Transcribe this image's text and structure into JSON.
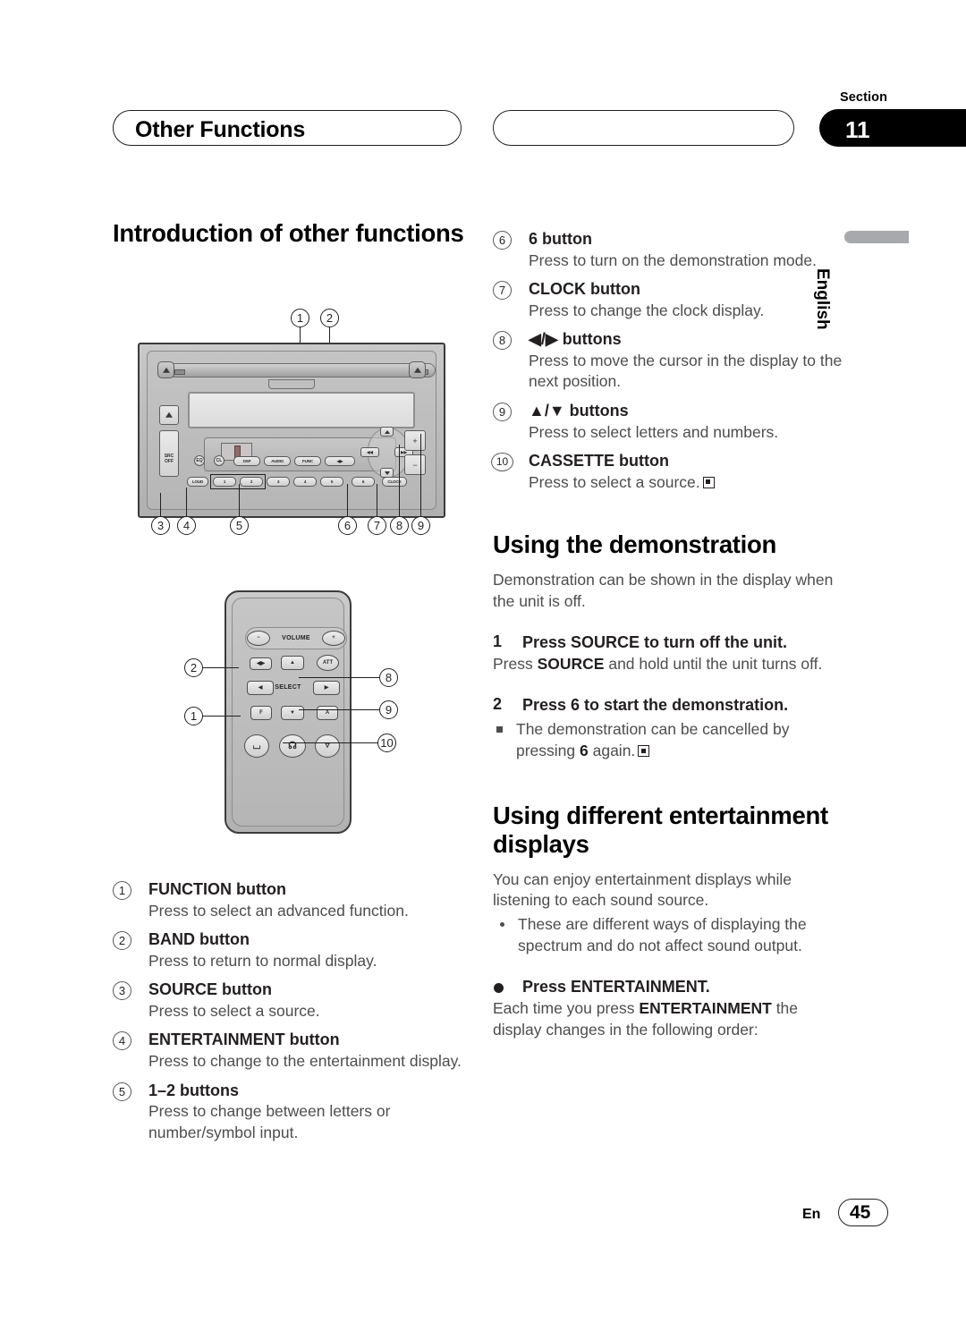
{
  "header": {
    "left_pill_title": "Other Functions",
    "right_pill_title": "",
    "section_word": "Section",
    "section_number": "11"
  },
  "side_tab": {
    "language": "English"
  },
  "left_column": {
    "heading": "Introduction of other functions",
    "button_list": [
      {
        "num": "1",
        "term": "FUNCTION button",
        "desc": "Press to select an advanced function."
      },
      {
        "num": "2",
        "term": "BAND button",
        "desc": "Press to return to normal display."
      },
      {
        "num": "3",
        "term": "SOURCE button",
        "desc": "Press to select a source."
      },
      {
        "num": "4",
        "term": "ENTERTAINMENT button",
        "desc": "Press to change to the entertainment display."
      },
      {
        "num": "5",
        "term": "1–2 buttons",
        "desc": "Press to change between letters or number/symbol input."
      }
    ]
  },
  "right_column": {
    "button_list": [
      {
        "num": "6",
        "term": "6 button",
        "desc": "Press to turn on the demonstration mode."
      },
      {
        "num": "7",
        "term": "CLOCK button",
        "desc": "Press to change the clock display."
      },
      {
        "num": "8",
        "term": "◀/▶ buttons",
        "desc": "Press to move the cursor in the display to the next position."
      },
      {
        "num": "9",
        "term": "▲/▼ buttons",
        "desc": "Press to select letters and numbers."
      },
      {
        "num": "10",
        "term": "CASSETTE button",
        "desc": "Press to select a source."
      }
    ],
    "demo": {
      "heading": "Using the demonstration",
      "intro": "Demonstration can be shown in the display when the unit is off.",
      "step1_num": "1",
      "step1_head": "Press SOURCE to turn off the unit.",
      "step1_body_a": "Press ",
      "step1_body_bold": "SOURCE",
      "step1_body_b": " and hold until the unit turns off.",
      "step2_num": "2",
      "step2_head": "Press 6 to start the demonstration.",
      "step2_note_a": "The demonstration can be cancelled by pressing ",
      "step2_note_bold": "6",
      "step2_note_b": " again."
    },
    "entertainment": {
      "heading": "Using different entertainment displays",
      "intro": "You can enjoy entertainment displays while listening to each sound source.",
      "bullet": "These are different ways of displaying the spectrum and do not affect sound output.",
      "step_head": "Press ENTERTAINMENT.",
      "step_body_a": "Each time you press ",
      "step_body_bold": "ENTERTAINMENT",
      "step_body_b": " the display changes in the following order:"
    }
  },
  "head_unit_diagram": {
    "callouts_top": [
      "1",
      "2"
    ],
    "callouts_bottom": [
      "3",
      "4",
      "5",
      "6",
      "7",
      "8",
      "9"
    ],
    "buttons": {
      "src_off": "SRC\nOFF",
      "eq": "EQ",
      "clock_small": "CL",
      "dsp": "DSP",
      "audio": "AUDIO",
      "func": "FUNC",
      "arrows": "◀▶",
      "loud": "LOUD",
      "clock": "CLOCK",
      "presets": [
        "1",
        "2",
        "3",
        "4",
        "5",
        "6"
      ],
      "pad_prev": "◀◀",
      "pad_next": "▶▶",
      "vol_up": "+",
      "vol_down": "−"
    }
  },
  "remote_diagram": {
    "callouts": [
      "1",
      "2",
      "8",
      "9",
      "10"
    ],
    "labels": {
      "volume": "VOLUME",
      "select": "SELECT",
      "minus": "−",
      "plus": "+",
      "att": "ATT",
      "f": "F",
      "a": "A",
      "arrows_lr": "◀▶",
      "up": "▲",
      "down": "▼",
      "left": "◀",
      "right": "▶"
    }
  },
  "footer": {
    "lang_code": "En",
    "page_number": "45"
  }
}
